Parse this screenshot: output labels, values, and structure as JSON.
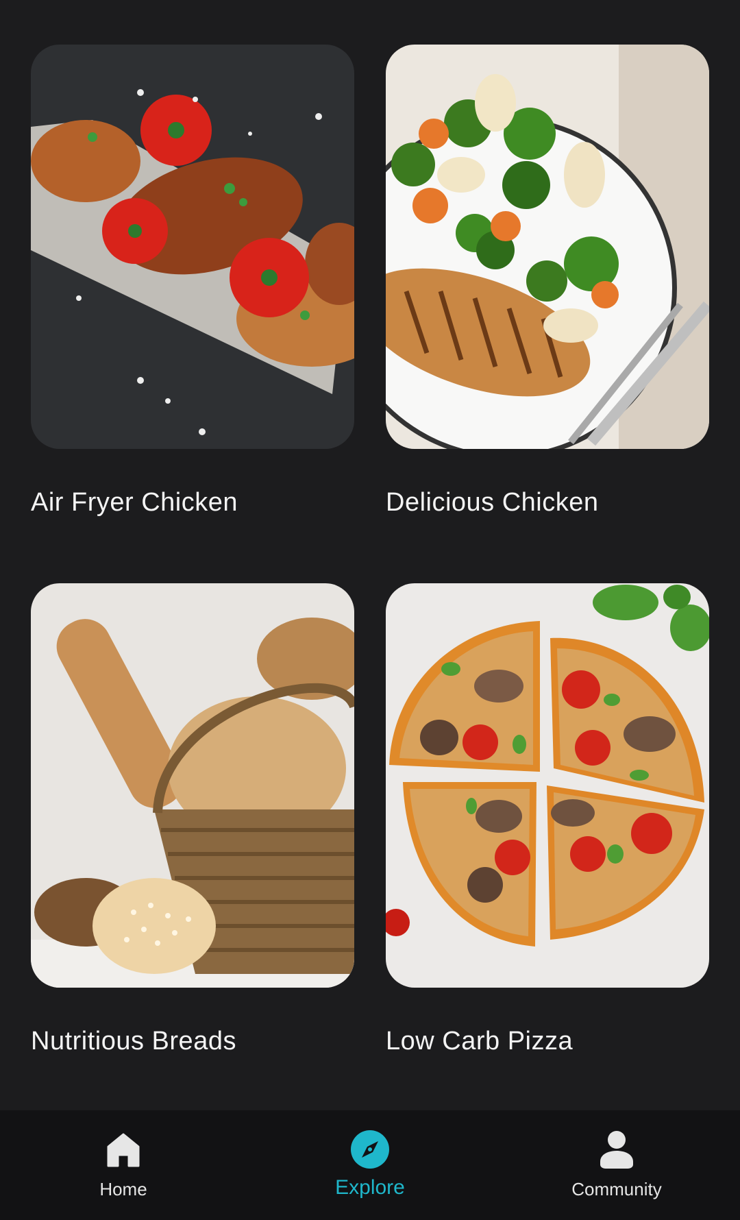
{
  "recipes": [
    {
      "title": "Air Fryer Chicken"
    },
    {
      "title": "Delicious Chicken"
    },
    {
      "title": "Nutritious Breads"
    },
    {
      "title": "Low Carb Pizza"
    }
  ],
  "nav": {
    "items": [
      {
        "label": "Home",
        "icon": "home-icon",
        "active": false
      },
      {
        "label": "Explore",
        "icon": "compass-icon",
        "active": true
      },
      {
        "label": "Community",
        "icon": "person-icon",
        "active": false
      }
    ]
  },
  "colors": {
    "background": "#1c1c1e",
    "nav_background": "#121214",
    "accent": "#1fb7cb",
    "text": "#ffffff"
  }
}
